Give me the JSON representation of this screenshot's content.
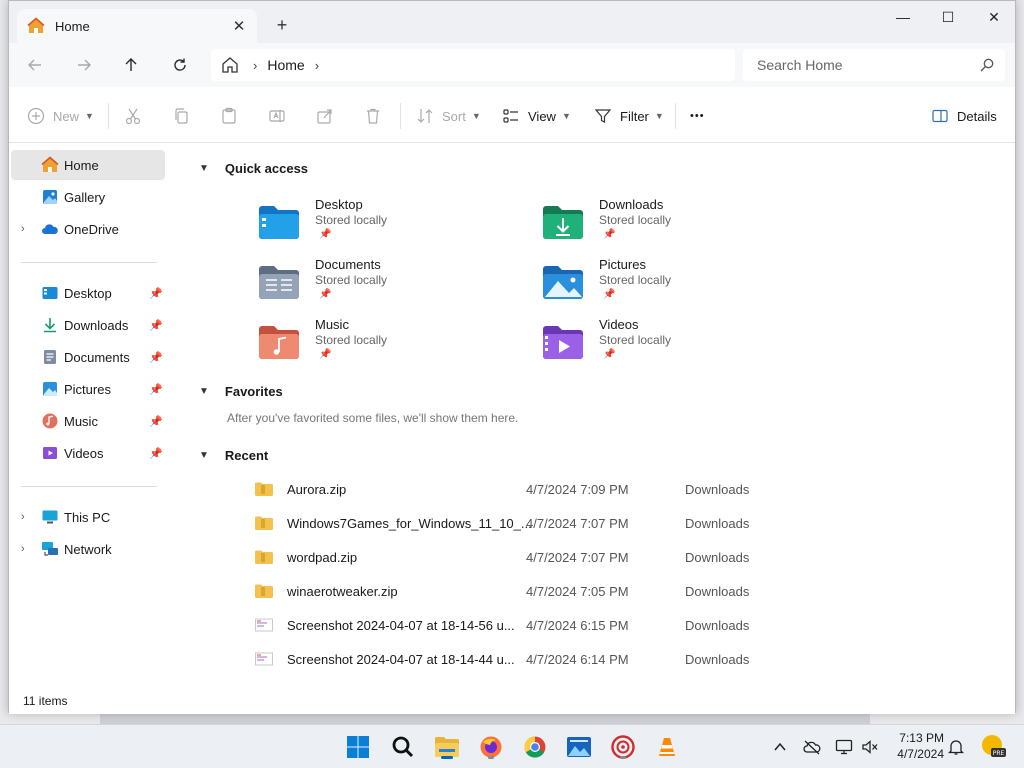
{
  "window": {
    "tab_title": "Home",
    "new_tab": "+",
    "controls": {
      "minimize": "—",
      "maximize": "☐",
      "close": "✕"
    }
  },
  "nav": {
    "breadcrumb": [
      "Home"
    ],
    "search_placeholder": "Search Home"
  },
  "toolbar": {
    "new": "New",
    "sort": "Sort",
    "view": "View",
    "filter": "Filter",
    "more": "•••",
    "details": "Details"
  },
  "sidebar": {
    "top": [
      {
        "label": "Home",
        "icon": "home-icon",
        "selected": true
      },
      {
        "label": "Gallery",
        "icon": "gallery-icon"
      },
      {
        "label": "OneDrive",
        "icon": "onedrive-icon",
        "expandable": true
      }
    ],
    "pinned": [
      {
        "label": "Desktop",
        "icon": "desktop-folder-icon"
      },
      {
        "label": "Downloads",
        "icon": "downloads-icon"
      },
      {
        "label": "Documents",
        "icon": "documents-icon"
      },
      {
        "label": "Pictures",
        "icon": "pictures-icon"
      },
      {
        "label": "Music",
        "icon": "music-icon"
      },
      {
        "label": "Videos",
        "icon": "videos-icon"
      }
    ],
    "bottom": [
      {
        "label": "This PC",
        "icon": "this-pc-icon"
      },
      {
        "label": "Network",
        "icon": "network-icon"
      }
    ]
  },
  "content": {
    "quick_access_title": "Quick access",
    "quick_access": [
      {
        "name": "Desktop",
        "sub": "Stored locally",
        "icon": "desktop-folder-icon",
        "color": "#1a8ad4"
      },
      {
        "name": "Downloads",
        "sub": "Stored locally",
        "icon": "downloads-folder-icon",
        "color": "#1c9a6c"
      },
      {
        "name": "Documents",
        "sub": "Stored locally",
        "icon": "documents-folder-icon",
        "color": "#7d8da2"
      },
      {
        "name": "Pictures",
        "sub": "Stored locally",
        "icon": "pictures-folder-icon",
        "color": "#2a8fdc"
      },
      {
        "name": "Music",
        "sub": "Stored locally",
        "icon": "music-folder-icon",
        "color": "#e0725d"
      },
      {
        "name": "Videos",
        "sub": "Stored locally",
        "icon": "videos-folder-icon",
        "color": "#8a4fd6"
      }
    ],
    "favorites_title": "Favorites",
    "favorites_note": "After you've favorited some files, we'll show them here.",
    "recent_title": "Recent",
    "recent": [
      {
        "name": "Aurora.zip",
        "date": "4/7/2024 7:09 PM",
        "location": "Downloads",
        "type": "zip"
      },
      {
        "name": "Windows7Games_for_Windows_11_10_...",
        "date": "4/7/2024 7:07 PM",
        "location": "Downloads",
        "type": "zip"
      },
      {
        "name": "wordpad.zip",
        "date": "4/7/2024 7:07 PM",
        "location": "Downloads",
        "type": "zip"
      },
      {
        "name": "winaerotweaker.zip",
        "date": "4/7/2024 7:05 PM",
        "location": "Downloads",
        "type": "zip"
      },
      {
        "name": "Screenshot 2024-04-07 at 18-14-56 u...",
        "date": "4/7/2024 6:15 PM",
        "location": "Downloads",
        "type": "image"
      },
      {
        "name": "Screenshot 2024-04-07 at 18-14-44 u...",
        "date": "4/7/2024 6:14 PM",
        "location": "Downloads",
        "type": "image"
      }
    ]
  },
  "status": {
    "items": "11 items"
  },
  "taskbar": {
    "apps": [
      "start-icon",
      "search-icon",
      "file-explorer-icon",
      "firefox-icon",
      "chrome-icon",
      "photos-icon",
      "media-app-icon",
      "vlc-icon"
    ],
    "time": "7:13 PM",
    "date": "4/7/2024",
    "badge": "PRE"
  }
}
